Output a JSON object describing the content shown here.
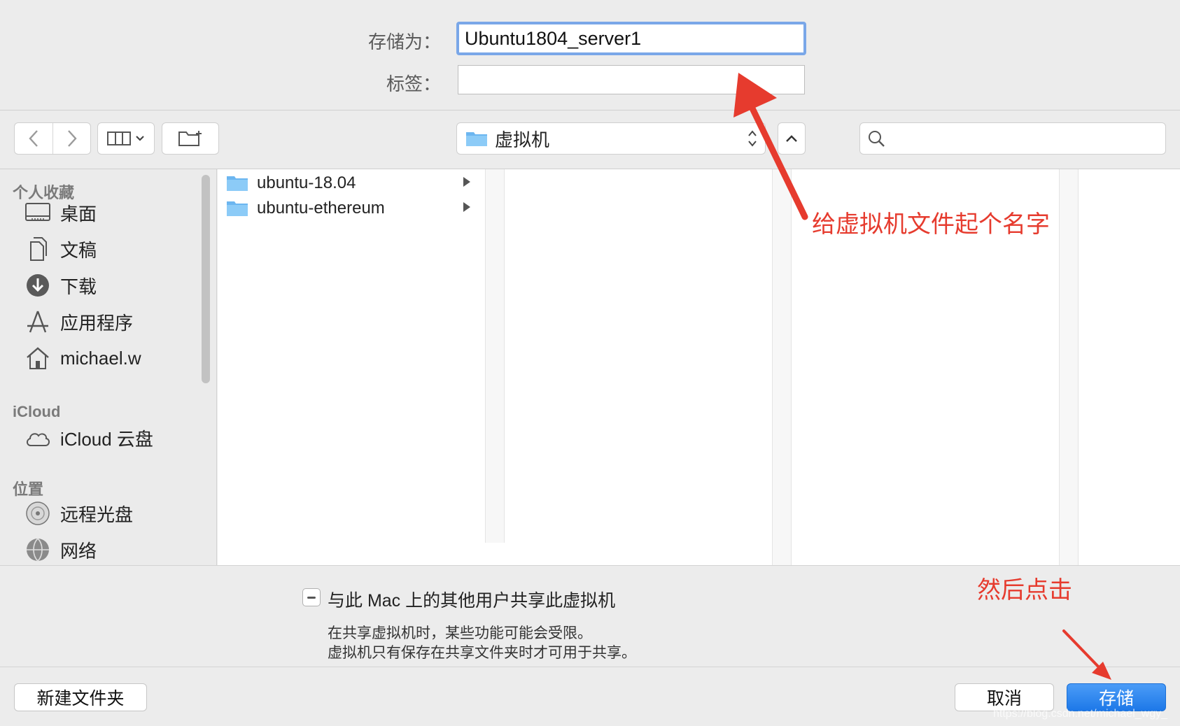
{
  "header": {
    "save_as_label": "存储为：",
    "save_as_value": "Ubuntu1804_server1",
    "tags_label": "标签："
  },
  "toolbar": {
    "location": "虚拟机",
    "search_placeholder": ""
  },
  "sidebar": {
    "favorites_title": "个人收藏",
    "favorites": [
      {
        "label": "桌面",
        "icon": "desktop-icon"
      },
      {
        "label": "文稿",
        "icon": "document-icon"
      },
      {
        "label": "下载",
        "icon": "download-icon"
      },
      {
        "label": "应用程序",
        "icon": "applications-icon"
      },
      {
        "label": "michael.w",
        "icon": "home-icon"
      }
    ],
    "icloud_title": "iCloud",
    "icloud": [
      {
        "label": "iCloud 云盘",
        "icon": "cloud-icon"
      }
    ],
    "locations_title": "位置",
    "locations": [
      {
        "label": "远程光盘",
        "icon": "disc-icon"
      },
      {
        "label": "网络",
        "icon": "network-icon"
      }
    ]
  },
  "browser": {
    "items": [
      {
        "name": "ubuntu-18.04"
      },
      {
        "name": "ubuntu-ethereum"
      }
    ]
  },
  "options": {
    "share_label": "与此 Mac 上的其他用户共享此虚拟机",
    "note_line1": "在共享虚拟机时，某些功能可能会受限。",
    "note_line2": "虚拟机只有保存在共享文件夹时才可用于共享。"
  },
  "footer": {
    "new_folder_label": "新建文件夹",
    "cancel_label": "取消",
    "save_label": "存储"
  },
  "annotations": {
    "name_hint": "给虚拟机文件起个名字",
    "click_hint": "然后点击"
  },
  "watermark": "https://blog.csdn.net/michael_wgy_",
  "colors": {
    "accent": "#1d78e8",
    "focus_ring": "#7aa7e8",
    "annotation": "#e63b2e",
    "folder": "#6cb6f0"
  }
}
